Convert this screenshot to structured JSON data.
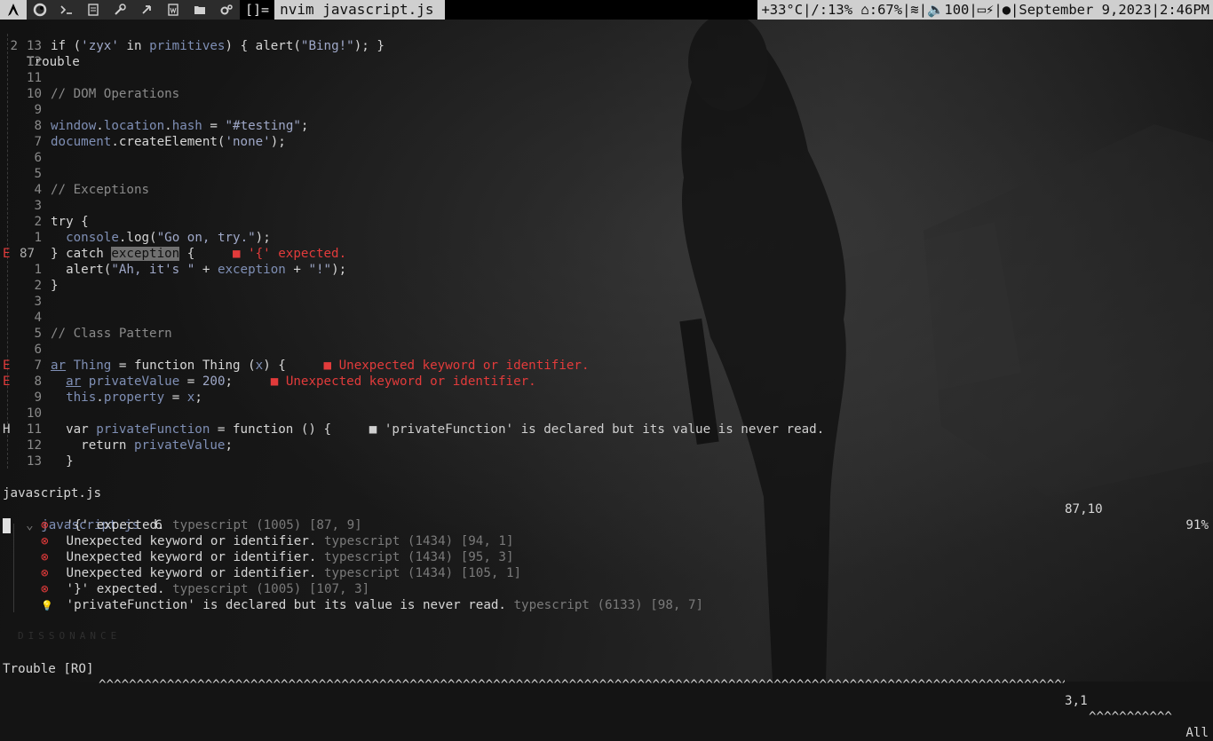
{
  "topbar": {
    "workspaces": [
      {
        "icon": "arch-logo-icon",
        "active": true
      },
      {
        "icon": "firefox-icon",
        "active": false
      },
      {
        "icon": "terminal-icon",
        "active": false
      },
      {
        "icon": "document-icon",
        "active": false
      },
      {
        "icon": "tools-icon",
        "active": false
      },
      {
        "icon": "code-icon",
        "active": false
      },
      {
        "icon": "writer-icon",
        "active": false
      },
      {
        "icon": "folder-icon",
        "active": false
      },
      {
        "icon": "gears-icon",
        "active": false
      }
    ],
    "layout_symbol": "[]=",
    "window_title": "nvim javascript.js",
    "status_text": "+33°C|/:13% ⌂:67%|≋|🔈100|▭⚡|●|September 9,2023|2:46PM"
  },
  "editor": {
    "header": {
      "num": "2",
      "text": "Trouble"
    },
    "lines": [
      {
        "sign": "",
        "num": "13",
        "parts": [
          [
            "kw",
            "if ("
          ],
          [
            "str",
            "'zyx'"
          ],
          [
            "kw",
            " in "
          ],
          [
            "prop",
            "primitives"
          ],
          [
            "kw",
            ") { alert("
          ],
          [
            "str",
            "\"Bing!\""
          ],
          [
            "kw",
            "); }"
          ]
        ]
      },
      {
        "sign": "",
        "num": "12",
        "parts": []
      },
      {
        "sign": "",
        "num": "11",
        "parts": []
      },
      {
        "sign": "",
        "num": "10",
        "parts": [
          [
            "cmt",
            "// DOM Operations"
          ]
        ]
      },
      {
        "sign": "",
        "num": "9",
        "parts": []
      },
      {
        "sign": "",
        "num": "8",
        "parts": [
          [
            "prop",
            "window"
          ],
          [
            "kw",
            "."
          ],
          [
            "prop",
            "location"
          ],
          [
            "kw",
            "."
          ],
          [
            "prop",
            "hash"
          ],
          [
            "kw",
            " = "
          ],
          [
            "str",
            "\"#testing\""
          ],
          [
            "kw",
            ";"
          ]
        ]
      },
      {
        "sign": "",
        "num": "7",
        "parts": [
          [
            "prop",
            "document"
          ],
          [
            "kw",
            ".createElement("
          ],
          [
            "str",
            "'none'"
          ],
          [
            "kw",
            ");"
          ]
        ]
      },
      {
        "sign": "",
        "num": "6",
        "parts": []
      },
      {
        "sign": "",
        "num": "5",
        "parts": []
      },
      {
        "sign": "",
        "num": "4",
        "parts": [
          [
            "cmt",
            "// Exceptions"
          ]
        ]
      },
      {
        "sign": "",
        "num": "3",
        "parts": []
      },
      {
        "sign": "",
        "num": "2",
        "parts": [
          [
            "kw",
            "try {"
          ]
        ]
      },
      {
        "sign": "",
        "num": "1",
        "parts": [
          [
            "kw",
            "  "
          ],
          [
            "prop",
            "console"
          ],
          [
            "kw",
            ".log("
          ],
          [
            "str",
            "\"Go on, try.\""
          ],
          [
            "kw",
            ");"
          ]
        ]
      },
      {
        "sign": "E",
        "num": "87",
        "current": true,
        "parts": [
          [
            "kw",
            "} catch "
          ],
          [
            "hl",
            "exception"
          ],
          [
            "kw",
            " {     "
          ],
          [
            "err",
            "■ '{' expected."
          ]
        ]
      },
      {
        "sign": "",
        "num": "1",
        "parts": [
          [
            "kw",
            "  alert("
          ],
          [
            "str",
            "\"Ah, it's \""
          ],
          [
            "kw",
            " + "
          ],
          [
            "prop",
            "exception"
          ],
          [
            "kw",
            " + "
          ],
          [
            "str",
            "\"!\""
          ],
          [
            "kw",
            ");"
          ]
        ]
      },
      {
        "sign": "",
        "num": "2",
        "parts": [
          [
            "kw",
            "}"
          ]
        ]
      },
      {
        "sign": "",
        "num": "3",
        "parts": []
      },
      {
        "sign": "",
        "num": "4",
        "parts": []
      },
      {
        "sign": "",
        "num": "5",
        "parts": [
          [
            "cmt",
            "// Class Pattern"
          ]
        ]
      },
      {
        "sign": "",
        "num": "6",
        "parts": []
      },
      {
        "sign": "E",
        "num": "7",
        "parts": [
          [
            "ulprop",
            "ar"
          ],
          [
            "kw",
            " "
          ],
          [
            "prop",
            "Thing"
          ],
          [
            "kw",
            " = function Thing ("
          ],
          [
            "prop",
            "x"
          ],
          [
            "kw",
            ") {     "
          ],
          [
            "err",
            "■ Unexpected keyword or identifier."
          ]
        ]
      },
      {
        "sign": "E",
        "num": "8",
        "parts": [
          [
            "kw",
            "  "
          ],
          [
            "ulprop",
            "ar"
          ],
          [
            "kw",
            " "
          ],
          [
            "prop",
            "privateValue"
          ],
          [
            "kw",
            " = "
          ],
          [
            "str",
            "200"
          ],
          [
            "kw",
            ";     "
          ],
          [
            "err",
            "■ Unexpected keyword or identifier."
          ]
        ]
      },
      {
        "sign": "",
        "num": "9",
        "parts": [
          [
            "kw",
            "  "
          ],
          [
            "prop",
            "this"
          ],
          [
            "kw",
            "."
          ],
          [
            "prop",
            "property"
          ],
          [
            "kw",
            " = "
          ],
          [
            "prop",
            "x"
          ],
          [
            "kw",
            ";"
          ]
        ]
      },
      {
        "sign": "",
        "num": "10",
        "parts": []
      },
      {
        "sign": "H",
        "num": "11",
        "parts": [
          [
            "kw",
            "  var "
          ],
          [
            "prop",
            "privateFunction"
          ],
          [
            "kw",
            " = function () {     "
          ],
          [
            "hint",
            "■ 'privateFunction' is declared but its value is never read."
          ]
        ]
      },
      {
        "sign": "",
        "num": "12",
        "parts": [
          [
            "kw",
            "    return "
          ],
          [
            "prop",
            "privateValue"
          ],
          [
            "kw",
            ";"
          ]
        ]
      },
      {
        "sign": "",
        "num": "13",
        "parts": [
          [
            "kw",
            "  }"
          ]
        ]
      }
    ],
    "statusline": {
      "file": "javascript.js",
      "position": "87,10",
      "percent": "91%"
    }
  },
  "trouble": {
    "file": "javascript.js",
    "count": "6",
    "items": [
      {
        "type": "error",
        "msg": "'{' expected.",
        "src": "typescript (1005) [87, 9]"
      },
      {
        "type": "error",
        "msg": "Unexpected keyword or identifier.",
        "src": "typescript (1434) [94, 1]"
      },
      {
        "type": "error",
        "msg": "Unexpected keyword or identifier.",
        "src": "typescript (1434) [95, 3]"
      },
      {
        "type": "error",
        "msg": "Unexpected keyword or identifier.",
        "src": "typescript (1434) [105, 1]"
      },
      {
        "type": "error",
        "msg": "'}' expected.",
        "src": "typescript (1005) [107, 3]"
      },
      {
        "type": "hint",
        "msg": "'privateFunction' is declared but its value is never read.",
        "src": "typescript (6133) [98, 7]"
      }
    ],
    "statusline": {
      "name": "Trouble [RO]",
      "fill": "^^^^^^^^^^^^^^^^^^^^^^^^^^^^^^^^^^^^^^^^^^^^^^^^^^^^^^^^^^^^^^^^^^^^^^^^^^^^^^^^^^^^^^^^^^^^^^^^^^^^^^^^^^^^^^^^^^^^^^^^^^^^^^^^^^^^^^^^^^^^^^^^^^^^^^^^^^",
      "position": "3,1",
      "fill2": "^^^^^^^^^^^",
      "scroll": "All"
    }
  },
  "wallpaper": {
    "watermark": "DISSONANCE"
  },
  "colors": {
    "error": "#e23b3b",
    "string": "#9fa8c8",
    "property": "#7f8fb5",
    "comment": "#8a8a8a",
    "bar": "#cfcfcf"
  }
}
